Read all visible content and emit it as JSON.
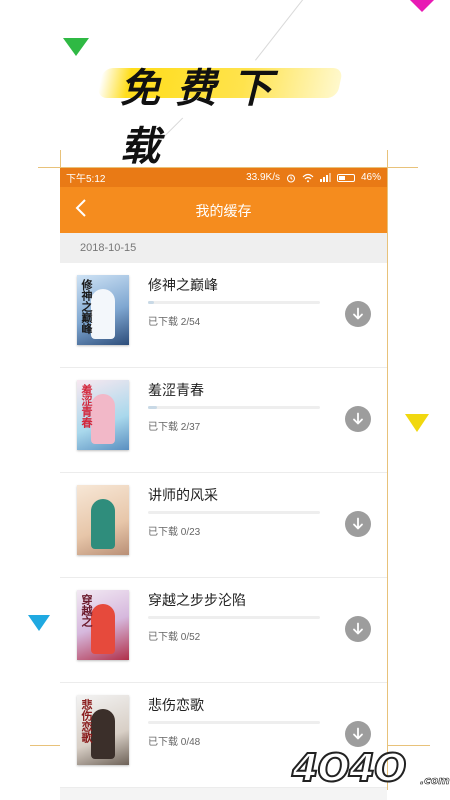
{
  "promo": {
    "banner_text": "免费下载"
  },
  "status_bar": {
    "time": "下午5:12",
    "net_speed": "33.9K/s",
    "battery": "46%",
    "battery_level": 0.46
  },
  "header": {
    "title": "我的缓存"
  },
  "date_group": "2018-10-15",
  "books": [
    {
      "title": "修神之巅峰",
      "status": "已下载 2/54",
      "progress": 0.037,
      "cover_text": "修神之巅峰"
    },
    {
      "title": "羞涩青春",
      "status": "已下载 2/37",
      "progress": 0.054,
      "cover_text": "羞涩青春"
    },
    {
      "title": "讲师的风采",
      "status": "已下载 0/23",
      "progress": 0,
      "cover_text": ""
    },
    {
      "title": "穿越之步步沦陷",
      "status": "已下载 0/52",
      "progress": 0,
      "cover_text": "穿越之"
    },
    {
      "title": "悲伤恋歌",
      "status": "已下载 0/48",
      "progress": 0,
      "cover_text": "悲伤恋歌"
    }
  ],
  "watermark": {
    "main": "4O4O",
    "domain": ".com"
  },
  "colors": {
    "accent": "#f58c1e",
    "status_bar": "#e97a15",
    "download_button": "#9d9d9d"
  },
  "icons": {
    "back": "chevron-left-icon",
    "download": "download-arrow-icon"
  }
}
